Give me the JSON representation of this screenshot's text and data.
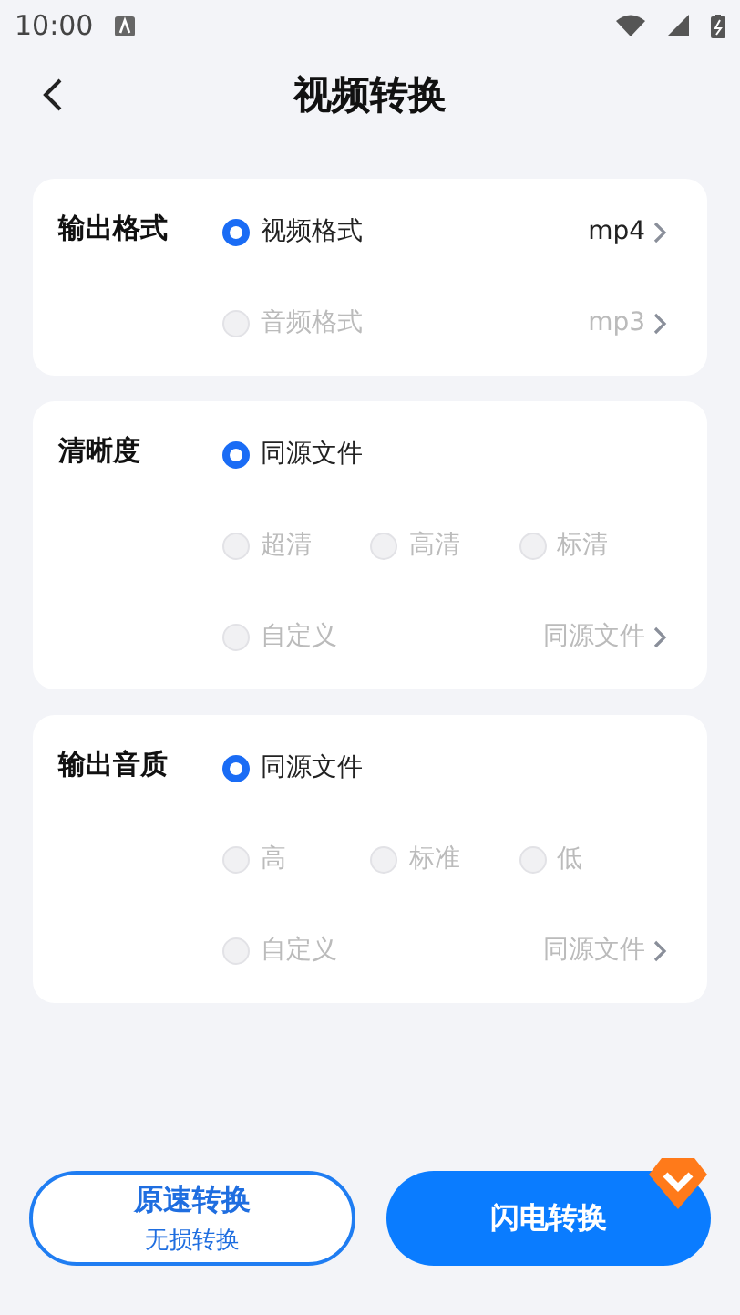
{
  "status_bar": {
    "time": "10:00"
  },
  "header": {
    "title": "视频转换"
  },
  "sections": [
    {
      "title": "输出格式",
      "rows": [
        {
          "options": [
            {
              "label": "视频格式",
              "selected": true
            }
          ],
          "value": "mp4"
        },
        {
          "options": [
            {
              "label": "音频格式",
              "selected": false
            }
          ],
          "value": "mp3"
        }
      ]
    },
    {
      "title": "清晰度",
      "rows": [
        {
          "options": [
            {
              "label": "同源文件",
              "selected": true
            }
          ]
        },
        {
          "options": [
            {
              "label": "超清",
              "selected": false
            },
            {
              "label": "高清",
              "selected": false
            },
            {
              "label": "标清",
              "selected": false
            }
          ]
        },
        {
          "options": [
            {
              "label": "自定义",
              "selected": false
            }
          ],
          "value": "同源文件"
        }
      ]
    },
    {
      "title": "输出音质",
      "rows": [
        {
          "options": [
            {
              "label": "同源文件",
              "selected": true
            }
          ]
        },
        {
          "options": [
            {
              "label": "高",
              "selected": false
            },
            {
              "label": "标准",
              "selected": false
            },
            {
              "label": "低",
              "selected": false
            }
          ]
        },
        {
          "options": [
            {
              "label": "自定义",
              "selected": false
            }
          ],
          "value": "同源文件"
        }
      ]
    }
  ],
  "actions": [
    {
      "kind": "outline",
      "label": "原速转换",
      "subtitle": "无损转换"
    },
    {
      "kind": "filled",
      "label": "闪电转换",
      "vip": true
    }
  ]
}
